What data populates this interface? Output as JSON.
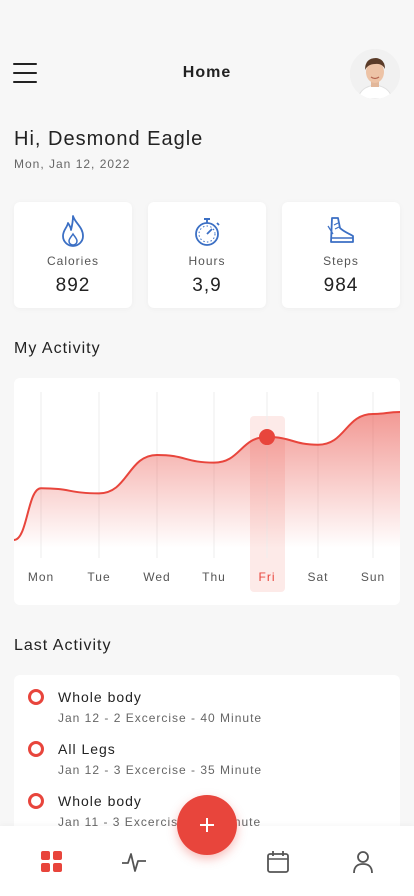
{
  "header": {
    "title": "Home"
  },
  "user": {
    "greeting": "Hi, Desmond Eagle",
    "date": "Mon, Jan 12, 2022"
  },
  "stats": [
    {
      "label": "Calories",
      "value": "892",
      "icon": "flame-icon"
    },
    {
      "label": "Hours",
      "value": "3,9",
      "icon": "stopwatch-icon"
    },
    {
      "label": "Steps",
      "value": "984",
      "icon": "sneaker-icon"
    }
  ],
  "activity_title": "My Activity",
  "chart_data": {
    "type": "area",
    "categories": [
      "Mon",
      "Tue",
      "Wed",
      "Thu",
      "Fri",
      "Sat",
      "Sun"
    ],
    "values": [
      0.42,
      0.38,
      0.68,
      0.62,
      0.82,
      0.76,
      1.0
    ],
    "highlight": "Fri",
    "accent": "#e8453c"
  },
  "last_activity_title": "Last Activity",
  "last_activity": [
    {
      "title": "Whole body",
      "detail": "Jan 12 - 2 Excercise - 40 Minute"
    },
    {
      "title": "All Legs",
      "detail": "Jan 12 - 3 Excercise - 35 Minute"
    },
    {
      "title": "Whole body",
      "detail": "Jan 11 - 3 Excercise - 35 Minute"
    }
  ],
  "nav": [
    "grid-icon",
    "activity-icon",
    "calendar-icon",
    "user-icon"
  ],
  "colors": {
    "accent": "#e8453c",
    "icon_blue": "#3b6fc4"
  }
}
